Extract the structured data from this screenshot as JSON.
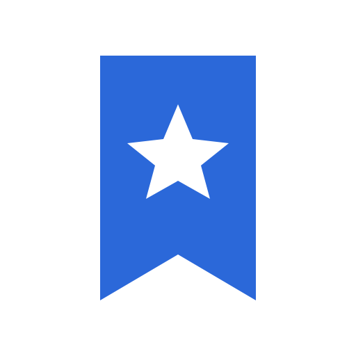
{
  "icon": {
    "name": "bookmark-star-icon",
    "ribbon_color": "#2b68d9",
    "star_color": "#ffffff",
    "background": "#ffffff"
  }
}
